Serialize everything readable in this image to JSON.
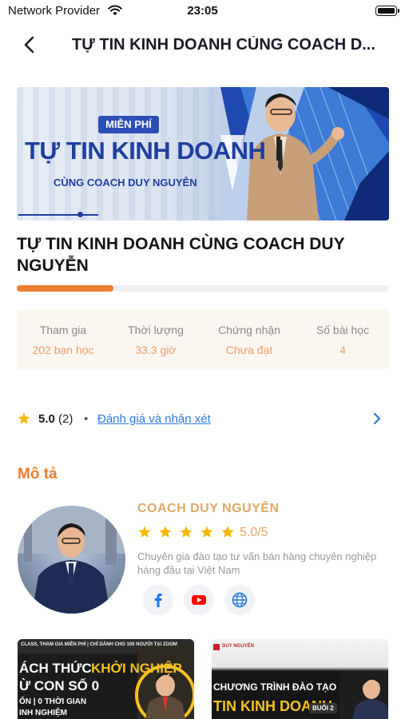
{
  "status_bar": {
    "carrier": "Network Provider",
    "time": "23:05"
  },
  "nav": {
    "title": "TỰ TIN KINH DOANH CÙNG COACH D..."
  },
  "banner": {
    "badge": "MIỄN PHÍ",
    "headline": "TỰ TIN KINH DOANH",
    "subline": "CÙNG COACH DUY NGUYỄN"
  },
  "course": {
    "title": "TỰ TIN KINH DOANH CÙNG COACH DUY NGUYỄN",
    "progress": 0.26
  },
  "stats": [
    {
      "label": "Tham gia",
      "value": "202 bạn học"
    },
    {
      "label": "Thời lượng",
      "value": "33.3 giờ"
    },
    {
      "label": "Chứng nhận",
      "value": "Chưa đạt"
    },
    {
      "label": "Số bài học",
      "value": "4"
    }
  ],
  "rating": {
    "score": "5.0",
    "count": "(2)",
    "separator": "•",
    "link_label": "Đánh giá và nhận xét"
  },
  "description": {
    "section_title": "Mô tả",
    "coach_name": "COACH DUY NGUYỄN",
    "coach_rating": "5.0/5",
    "coach_stars": 5,
    "coach_bio": "Chuyên gia đào tạo tư vấn bán hàng chuyên nghiệp hàng đầu tại Việt Nam"
  },
  "socials": [
    {
      "name": "facebook-icon",
      "color": "#1877f2"
    },
    {
      "name": "youtube-icon",
      "color": "#ff0000"
    },
    {
      "name": "website-icon",
      "color": "#2d7be0"
    }
  ],
  "cards": [
    {
      "top_line": "CLASS, THAM GIA MIỄN PHÍ  |  CHỈ DÀNH CHO 100 NGƯỜI TẠI ZOOM",
      "line1_a": "ÁCH THỨC",
      "line1_b": "KHỞI NGHIỆP",
      "line2": "Ừ CON SỐ 0",
      "line3": "ỐN | 0 THỜI GIAN",
      "line4": "INH NGHIỆM"
    },
    {
      "brand": "DUY NGUYỄN",
      "line1": "CHƯƠNG TRÌNH ĐÀO TẠO",
      "line2": "TIN KINH DOANH",
      "badge": "BUỔI 2"
    }
  ],
  "colors": {
    "accent": "#ee7d2d",
    "gold": "#e0a868",
    "link": "#2d7be0",
    "star": "#f5b800"
  }
}
